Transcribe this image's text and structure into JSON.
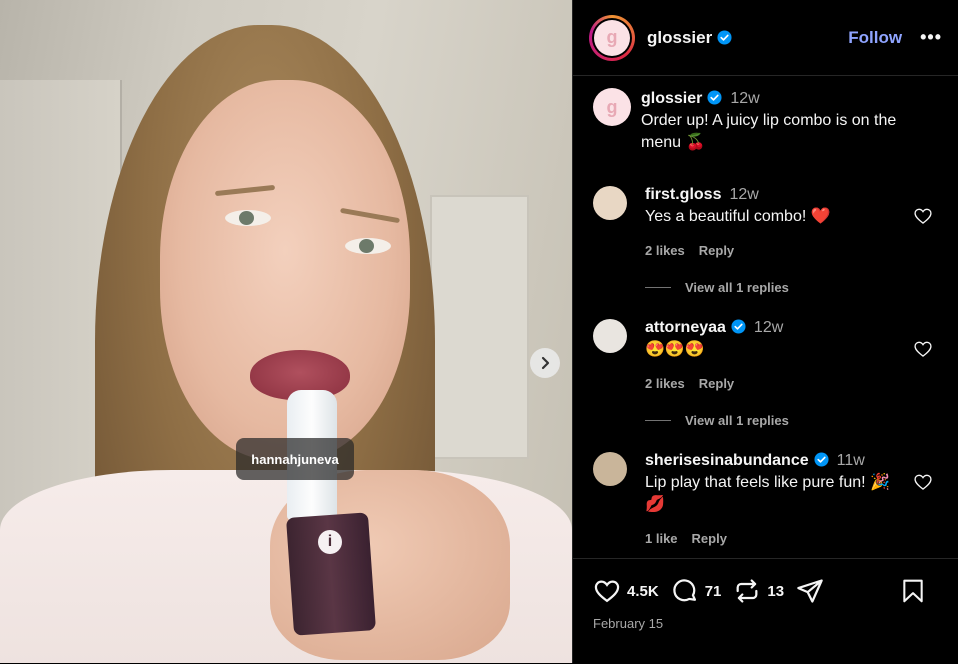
{
  "media": {
    "tagged_user": "hannahjuneva",
    "product_logo_letter": "i"
  },
  "post": {
    "author": "glossier",
    "follow_label": "Follow",
    "more_label": "•••",
    "caption": {
      "username": "glossier",
      "time": "12w",
      "text": "Order up! A juicy lip combo is on the menu 🍒"
    }
  },
  "comments": [
    {
      "username": "first.gloss",
      "verified": false,
      "time": "12w",
      "text": "Yes a beautiful combo! ❤️",
      "likes": "2 likes",
      "reply": "Reply",
      "view_replies": "View all 1 replies",
      "avatar_color": "#e8d7c4"
    },
    {
      "username": "attorneyaa",
      "verified": true,
      "time": "12w",
      "text": "😍😍😍",
      "likes": "2 likes",
      "reply": "Reply",
      "view_replies": "View all 1 replies",
      "avatar_color": "#e9e5e0"
    },
    {
      "username": "sherisesinabundance",
      "verified": true,
      "time": "11w",
      "text": "Lip play that feels like pure fun! 🎉💋",
      "likes": "1 like",
      "reply": "Reply",
      "avatar_color": "#c9b59a"
    }
  ],
  "actions": {
    "likes": "4.5K",
    "comments": "71",
    "reposts": "13",
    "date": "February 15"
  },
  "colors": {
    "follow": "#8fa4ff",
    "verified": "#0095f6",
    "heart": "#e02433"
  }
}
